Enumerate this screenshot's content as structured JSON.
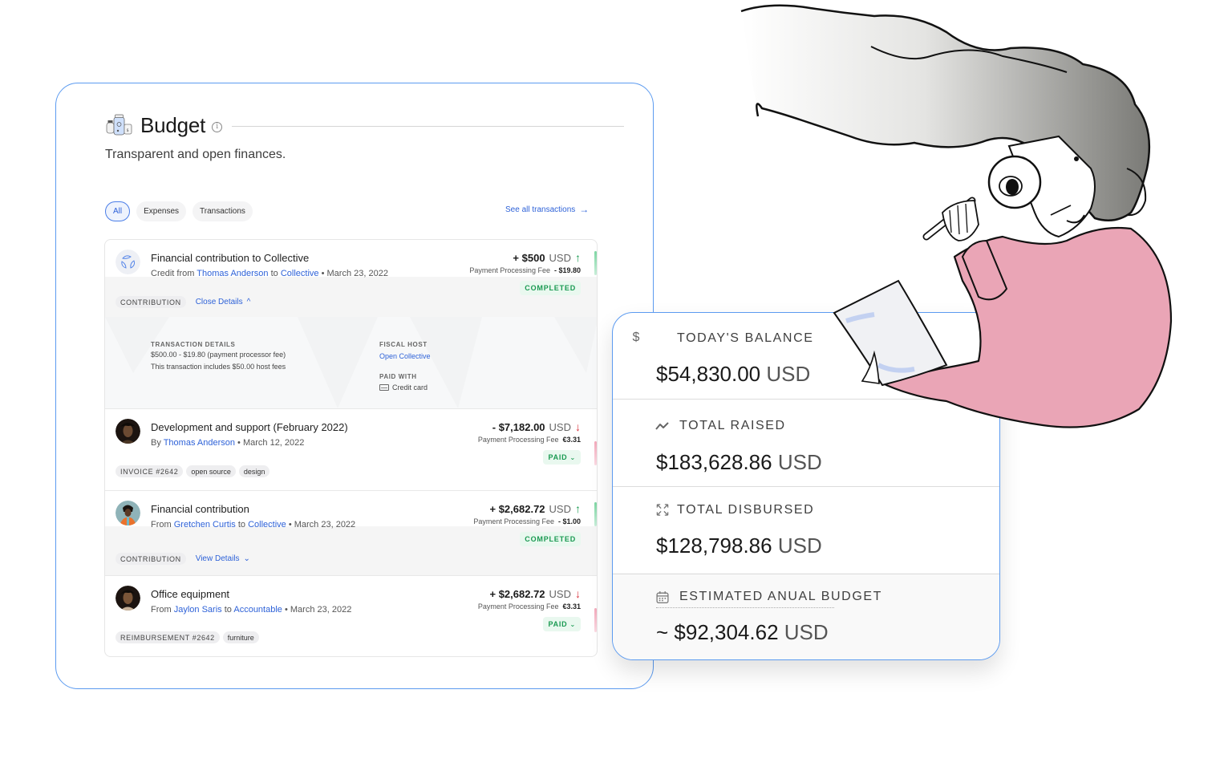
{
  "budget": {
    "title": "Budget",
    "info_glyph": "i",
    "subtitle": "Transparent and open finances.",
    "filters": [
      {
        "label": "All",
        "active": true
      },
      {
        "label": "Expenses",
        "active": false
      },
      {
        "label": "Transactions",
        "active": false
      }
    ],
    "see_all_label": "See all transactions",
    "see_all_arrow": "→"
  },
  "transactions": [
    {
      "title": "Financial contribution to Collective",
      "prefix": "Credit from",
      "from": "Thomas Anderson",
      "connector": "to",
      "to": "Collective",
      "date": "• March 23, 2022",
      "amount": "+ $500",
      "currency": "USD",
      "direction_arrow": "↑",
      "fee_label": "Payment Processing Fee",
      "fee_value": "- $19.80",
      "status": "COMPLETED",
      "tags": [
        "CONTRIBUTION"
      ],
      "details_toggle": "Close Details",
      "details_toggle_chevron": "^",
      "details": {
        "tx_label": "TRANSACTION DETAILS",
        "tx_line1": "$500.00 - $19.80 (payment processor fee)",
        "tx_line2": "This transaction includes $50.00 host fees",
        "host_label": "FISCAL HOST",
        "host_value": "Open Collective",
        "paid_label": "PAID WITH",
        "paid_value": "Credit card"
      }
    },
    {
      "title": "Development and support (February 2022)",
      "prefix": "By",
      "from": "Thomas Anderson",
      "date": "• March 12, 2022",
      "amount": "- $7,182.00",
      "currency": "USD",
      "direction_arrow": "↓",
      "fee_label": "Payment Processing Fee",
      "fee_value": "€3.31",
      "status": "PAID",
      "status_chevron": "⌄",
      "tags": [
        "INVOICE #2642",
        "open source",
        "design"
      ]
    },
    {
      "title": "Financial contribution",
      "prefix": "From",
      "from": "Gretchen Curtis",
      "connector": "to",
      "to": "Collective",
      "date": "• March 23, 2022",
      "amount": "+ $2,682.72",
      "currency": "USD",
      "direction_arrow": "↑",
      "fee_label": "Payment Processing Fee",
      "fee_value": "- $1.00",
      "status": "COMPLETED",
      "tags": [
        "CONTRIBUTION"
      ],
      "details_toggle": "View Details",
      "details_toggle_chevron": "⌄"
    },
    {
      "title": "Office equipment",
      "prefix": "From",
      "from": "Jaylon Saris",
      "connector": "to",
      "to": "Accountable",
      "date": "• March 23, 2022",
      "amount": "+ $2,682.72",
      "currency": "USD",
      "direction_arrow": "↓",
      "fee_label": "Payment Processing Fee",
      "fee_value": "€3.31",
      "status": "PAID",
      "status_chevron": "⌄",
      "tags": [
        "REIMBURSEMENT #2642",
        "furniture"
      ]
    }
  ],
  "stats": [
    {
      "icon": "$",
      "label": "TODAY'S BALANCE",
      "value": "$54,830.00",
      "currency": "USD"
    },
    {
      "icon": "〰",
      "label": "TOTAL RAISED",
      "value": "$183,628.86",
      "currency": "USD"
    },
    {
      "icon": "⤢",
      "label": "TOTAL DISBURSED",
      "value": "$128,798.86",
      "currency": "USD"
    },
    {
      "icon": "▦",
      "label": "ESTIMATED ANUAL BUDGET",
      "value": "~ $92,304.62",
      "currency": "USD"
    }
  ],
  "colors": {
    "accent_blue": "#5c9bf0",
    "link_blue": "#2e62d8",
    "positive_green": "#1a9a52",
    "negative_red": "#d8343f",
    "sweater_pink": "#e9a0b4"
  }
}
